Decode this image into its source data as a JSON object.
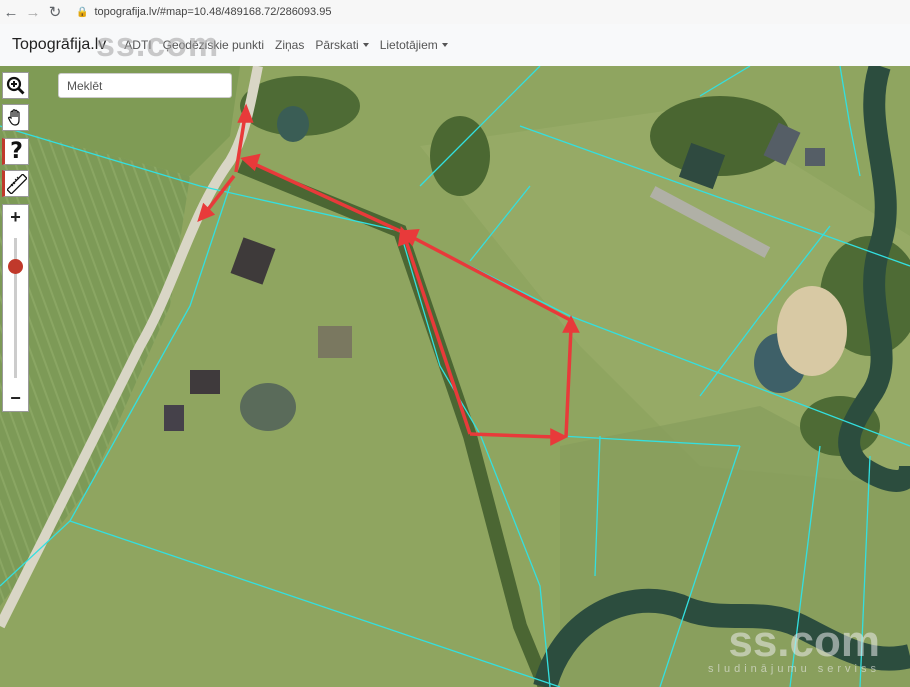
{
  "browser": {
    "back_icon": "arrow-left-icon",
    "forward_icon": "arrow-right-icon",
    "reload_icon": "reload-icon",
    "url": "topografija.lv/#map=10.48/489168.72/286093.95"
  },
  "site": {
    "brand": "Topogrāfija.lv",
    "menu": [
      "ADTI",
      "Ģeodēziskie punkti",
      "Ziņas"
    ],
    "dropdowns": [
      "Pārskati",
      "Lietotājiem"
    ]
  },
  "watermark": {
    "main": "ss.com",
    "sub": "sludinājumu serviss"
  },
  "map": {
    "search_placeholder": "Meklēt",
    "tools": [
      "zoom-in-icon",
      "hand-pan-icon",
      "help-icon",
      "ruler-icon"
    ],
    "zoom_plus": "+",
    "zoom_minus": "−",
    "zoom_level": 0.2,
    "parcel_color": "#33e0e0",
    "arrow_color": "#e83a3a"
  }
}
